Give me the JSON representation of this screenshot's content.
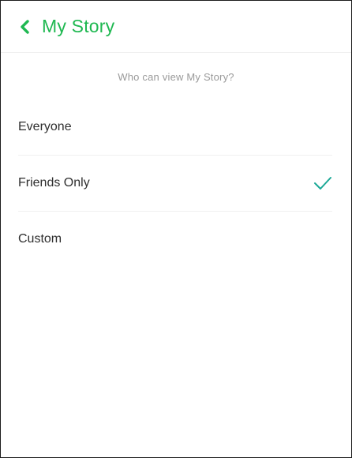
{
  "header": {
    "title": "My Story",
    "back_icon": "chevron-left-icon",
    "accent_color": "#1fb851"
  },
  "subtitle": "Who can view My Story?",
  "options": [
    {
      "label": "Everyone",
      "selected": false
    },
    {
      "label": "Friends Only",
      "selected": true
    },
    {
      "label": "Custom",
      "selected": false
    }
  ],
  "check_icon": "checkmark-icon",
  "check_color": "#1aa896"
}
